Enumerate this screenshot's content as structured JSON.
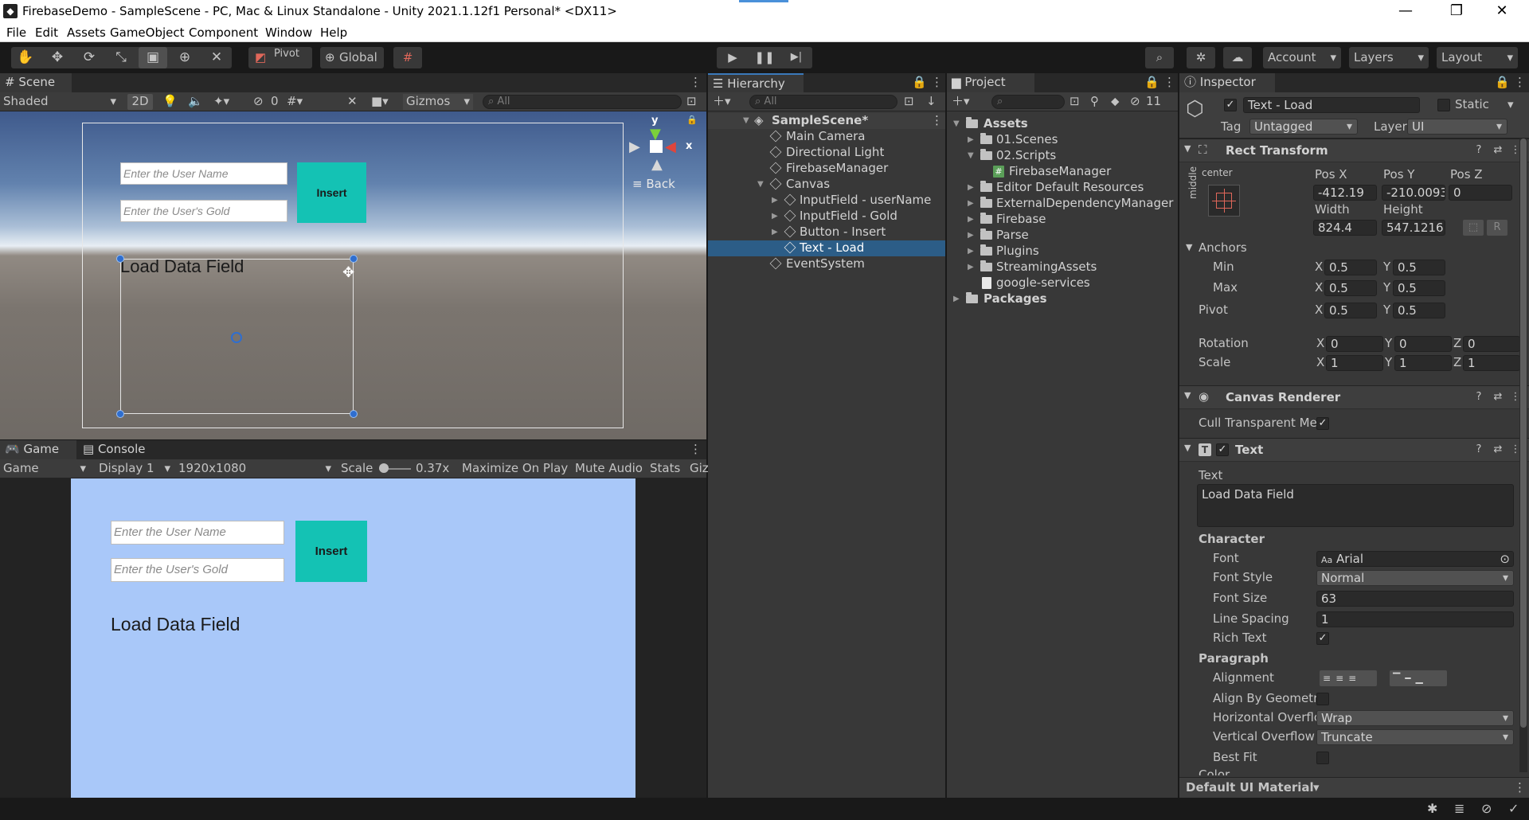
{
  "window": {
    "title": "FirebaseDemo - SampleScene - PC, Mac & Linux Standalone - Unity 2021.1.12f1 Personal* <DX11>",
    "minimize": "—",
    "maximize": "❐",
    "close": "✕"
  },
  "menu": [
    "File",
    "Edit",
    "Assets",
    "GameObject",
    "Component",
    "Window",
    "Help"
  ],
  "toolbar": {
    "pivot_label": "Pivot",
    "global_label": "Global",
    "account_label": "Account",
    "layers_label": "Layers",
    "layout_label": "Layout"
  },
  "scene": {
    "tab_label": "Scene",
    "shading_mode": "Shaded",
    "mode_2d": "2D",
    "hidden_count": "0",
    "gizmos_label": "Gizmos",
    "search_placeholder": "All",
    "gizmo_y": "y",
    "gizmo_x": "x",
    "back_label": "≡ Back",
    "ui": {
      "username_placeholder": "Enter the User Name",
      "gold_placeholder": "Enter the User's Gold",
      "insert_button": "Insert",
      "load_text": "Load Data Field"
    }
  },
  "game": {
    "tab_label": "Game",
    "console_tab_label": "Console",
    "view_mode": "Game",
    "display": "Display 1",
    "resolution": "1920x1080",
    "scale_label": "Scale",
    "scale_value": "0.37x",
    "maximize_on_play": "Maximize On Play",
    "mute_audio": "Mute Audio",
    "stats": "Stats",
    "gizmos_short": "Giz",
    "ui": {
      "username_placeholder": "Enter the User Name",
      "gold_placeholder": "Enter the User's Gold",
      "insert_button": "Insert",
      "load_text": "Load Data Field"
    }
  },
  "hierarchy": {
    "tab_label": "Hierarchy",
    "search_placeholder": "All",
    "scene_name": "SampleScene*",
    "items": [
      {
        "label": "Main Camera"
      },
      {
        "label": "Directional Light"
      },
      {
        "label": "FirebaseManager"
      },
      {
        "label": "Canvas"
      },
      {
        "label": "InputField - userName"
      },
      {
        "label": "InputField - Gold"
      },
      {
        "label": "Button - Insert"
      },
      {
        "label": "Text - Load"
      },
      {
        "label": "EventSystem"
      }
    ]
  },
  "project": {
    "tab_label": "Project",
    "hidden_packages": "11",
    "items": [
      {
        "label": "Assets"
      },
      {
        "label": "01.Scenes"
      },
      {
        "label": "02.Scripts"
      },
      {
        "label": "FirebaseManager"
      },
      {
        "label": "Editor Default Resources"
      },
      {
        "label": "ExternalDependencyManager"
      },
      {
        "label": "Firebase"
      },
      {
        "label": "Parse"
      },
      {
        "label": "Plugins"
      },
      {
        "label": "StreamingAssets"
      },
      {
        "label": "google-services"
      },
      {
        "label": "Packages"
      }
    ]
  },
  "inspector": {
    "tab_label": "Inspector",
    "object_name": "Text - Load",
    "static_label": "Static",
    "tag_label": "Tag",
    "tag_value": "Untagged",
    "layer_label": "Layer",
    "layer_value": "UI",
    "rect_transform": {
      "header": "Rect Transform",
      "anchor_h": "center",
      "anchor_v": "middle",
      "pos_x_label": "Pos X",
      "pos_y_label": "Pos Y",
      "pos_z_label": "Pos Z",
      "pos_x": "-412.19",
      "pos_y": "-210.0093",
      "pos_z": "0",
      "width_label": "Width",
      "height_label": "Height",
      "width": "824.4",
      "height": "547.1216",
      "raw_btn": "R",
      "anchors_label": "Anchors",
      "min_label": "Min",
      "max_label": "Max",
      "pivot_label": "Pivot",
      "x": "X",
      "y": "Y",
      "z": "Z",
      "min_x": "0.5",
      "min_y": "0.5",
      "max_x": "0.5",
      "max_y": "0.5",
      "pivot_x": "0.5",
      "pivot_y": "0.5",
      "rotation_label": "Rotation",
      "rot_x": "0",
      "rot_y": "0",
      "rot_z": "0",
      "scale_label": "Scale",
      "scale_x": "1",
      "scale_y": "1",
      "scale_z": "1"
    },
    "canvas_renderer": {
      "header": "Canvas Renderer",
      "cull_label": "Cull Transparent Me",
      "cull_checked": "✓"
    },
    "text": {
      "header": "Text",
      "text_label": "Text",
      "text_value": "Load Data Field",
      "character_label": "Character",
      "font_label": "Font",
      "font_value": "Arial",
      "font_icon_text": "Aa",
      "font_style_label": "Font Style",
      "font_style_value": "Normal",
      "font_size_label": "Font Size",
      "font_size_value": "63",
      "line_spacing_label": "Line Spacing",
      "line_spacing_value": "1",
      "rich_text_label": "Rich Text",
      "rich_text_checked": "✓",
      "paragraph_label": "Paragraph",
      "alignment_label": "Alignment",
      "align_geometry_label": "Align By Geometry",
      "h_overflow_label": "Horizontal Overflo",
      "h_overflow_value": "Wrap",
      "v_overflow_label": "Vertical Overflow",
      "v_overflow_value": "Truncate",
      "best_fit_label": "Best Fit",
      "color_label": "Color"
    },
    "material_label": "Default UI Material"
  }
}
